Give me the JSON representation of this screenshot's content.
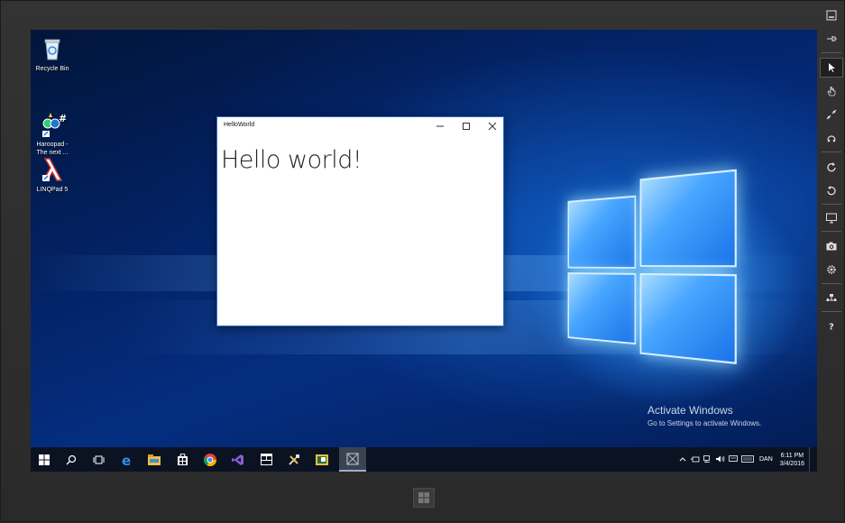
{
  "desktop": {
    "icons": [
      {
        "label": "Recycle Bin",
        "icon": "recycle-bin-icon"
      },
      {
        "label": "Haroopad -\nThe next ...",
        "icon": "haroopad-icon"
      },
      {
        "label": "LINQPad 5",
        "icon": "linqpad-icon"
      }
    ]
  },
  "app_window": {
    "title": "HelloWorld",
    "content": "Hello world!",
    "buttons": [
      "minimize",
      "maximize",
      "close"
    ]
  },
  "watermark": {
    "title": "Activate Windows",
    "subtitle": "Go to Settings to activate Windows."
  },
  "taskbar": {
    "items": [
      "start-icon",
      "search-icon",
      "task-view-icon",
      "edge-icon",
      "file-explorer-icon",
      "store-icon",
      "chrome-icon",
      "visual-studio-icon",
      "app-icon",
      "tools-icon",
      "image-app-icon",
      "helloworld-app-icon"
    ],
    "tray": {
      "language": "DAN",
      "time": "6:11 PM",
      "date": "3/4/2016"
    }
  },
  "toolbar": {
    "buttons": [
      "minimize",
      "always-on-top",
      "mouse-mode",
      "basic-touch-mode",
      "pinch-zoom-mode",
      "rotation-touch-mode",
      "rotate-clockwise",
      "rotate-counterclockwise",
      "change-resolution",
      "copy-screenshot",
      "network",
      "settings",
      "help"
    ]
  },
  "colors": {
    "accent": "#2e6bd1",
    "taskbar": "#0b1322",
    "frame": "#2b2b2b"
  }
}
